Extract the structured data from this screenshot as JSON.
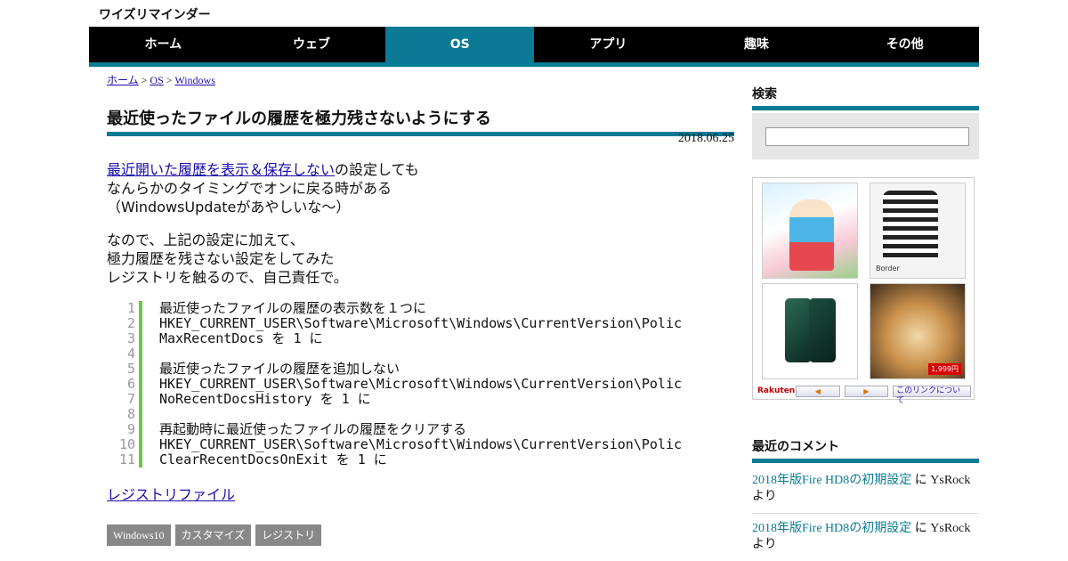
{
  "site": {
    "title": "ワイズリマインダー"
  },
  "nav": {
    "items": [
      "ホーム",
      "ウェブ",
      "OS",
      "アプリ",
      "趣味",
      "その他"
    ],
    "active_index": 2,
    "accent_color": "#0b7a94"
  },
  "breadcrumb": {
    "home": "ホーム",
    "sep": ">",
    "category": "OS",
    "current": "Windows"
  },
  "post": {
    "title": "最近使ったファイルの履歴を極力残さないようにする",
    "date": "2018.06.25",
    "intro_link": "最近開いた履歴を表示＆保存しない",
    "intro_line1_rest": "の設定しても",
    "intro_line2": "なんらかのタイミングでオンに戻る時がある",
    "intro_line3": "（WindowsUpdateがあやしいな～）",
    "para2_line1": "なので、上記の設定に加えて、",
    "para2_line2": "極力履歴を残さない設定をしてみた",
    "para2_line3": "レジストリを触るので、自己責任で。",
    "code_lines": [
      "最近使ったファイルの履歴の表示数を１つに",
      "HKEY_CURRENT_USER\\Software\\Microsoft\\Windows\\CurrentVersion\\Polic",
      "MaxRecentDocs を 1 に",
      "",
      "最近使ったファイルの履歴を追加しない",
      "HKEY_CURRENT_USER\\Software\\Microsoft\\Windows\\CurrentVersion\\Polic",
      "NoRecentDocsHistory を 1 に",
      "",
      "再起動時に最近使ったファイルの履歴をクリアする",
      "HKEY_CURRENT_USER\\Software\\Microsoft\\Windows\\CurrentVersion\\Polic",
      "ClearRecentDocsOnExit を 1 に"
    ],
    "line_numbers": [
      "1",
      "2",
      "3",
      "4",
      "5",
      "6",
      "7",
      "8",
      "9",
      "10",
      "11"
    ],
    "registry_link": "レジストリファイル",
    "tags": [
      "Windows10",
      "カスタマイズ",
      "レジストリ"
    ]
  },
  "sidebar": {
    "search_heading": "検索",
    "search_value": "",
    "ad": {
      "tile1_label": "Border",
      "sale_text": "1,999円",
      "rakuten": "Rakuten",
      "prev": "◀",
      "next": "▶",
      "link_text": "このリンクについて"
    },
    "comments_heading": "最近のコメント",
    "comments": [
      {
        "post": "2018年版Fire HD8の初期設定",
        "mid": " に ",
        "author": "YsRock",
        "suffix": "より"
      },
      {
        "post": "2018年版Fire HD8の初期設定",
        "mid": " に ",
        "author": "YsRock",
        "suffix": "より"
      }
    ]
  }
}
